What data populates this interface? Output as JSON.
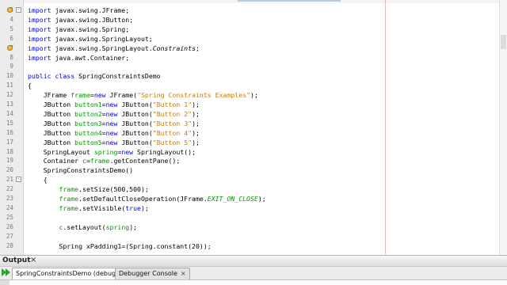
{
  "editor": {
    "lines": [
      {
        "n": "3",
        "fold": "-",
        "bulb": true,
        "tokens": [
          {
            "t": "import javax.swing.JFrame;",
            "c": "kw-lead"
          }
        ]
      },
      {
        "n": "4",
        "tokens": [
          {
            "t": "import javax.swing.JButton;",
            "c": "kw-lead"
          }
        ]
      },
      {
        "n": "5",
        "tokens": [
          {
            "t": "import javax.swing.Spring;",
            "c": "kw-lead"
          }
        ]
      },
      {
        "n": "6",
        "tokens": [
          {
            "t": "import javax.swing.SpringLayout;",
            "c": "kw-lead"
          }
        ]
      },
      {
        "n": "7",
        "bulb": true,
        "tokens": [
          {
            "t": "import",
            "c": "kw"
          },
          {
            "t": " javax.swing.SpringLayout.",
            "c": ""
          },
          {
            "t": "Constraints",
            "c": "ital"
          },
          {
            "t": ";",
            "c": ""
          }
        ]
      },
      {
        "n": "8",
        "tokens": [
          {
            "t": "import java.awt.Container;",
            "c": "kw-lead"
          }
        ]
      },
      {
        "n": "9",
        "tokens": []
      },
      {
        "n": "10",
        "tokens": [
          {
            "t": "public class",
            "c": "kw"
          },
          {
            "t": " SpringConstraintsDemo",
            "c": ""
          }
        ]
      },
      {
        "n": "11",
        "tokens": [
          {
            "t": "{",
            "c": ""
          }
        ]
      },
      {
        "n": "12",
        "tokens": [
          {
            "t": "    JFrame ",
            "c": ""
          },
          {
            "t": "frame",
            "c": "fld"
          },
          {
            "t": "=",
            "c": ""
          },
          {
            "t": "new",
            "c": "kw"
          },
          {
            "t": " JFrame(",
            "c": ""
          },
          {
            "t": "\"Spring Constraints Examples\"",
            "c": "str"
          },
          {
            "t": ");",
            "c": ""
          }
        ]
      },
      {
        "n": "13",
        "tokens": [
          {
            "t": "    JButton ",
            "c": ""
          },
          {
            "t": "button1",
            "c": "fld"
          },
          {
            "t": "=",
            "c": ""
          },
          {
            "t": "new",
            "c": "kw"
          },
          {
            "t": " JButton(",
            "c": ""
          },
          {
            "t": "\"Button 1\"",
            "c": "str"
          },
          {
            "t": ");",
            "c": ""
          }
        ]
      },
      {
        "n": "14",
        "tokens": [
          {
            "t": "    JButton ",
            "c": ""
          },
          {
            "t": "button2",
            "c": "fld"
          },
          {
            "t": "=",
            "c": ""
          },
          {
            "t": "new",
            "c": "kw"
          },
          {
            "t": " JButton(",
            "c": ""
          },
          {
            "t": "\"Button 2\"",
            "c": "str"
          },
          {
            "t": ");",
            "c": ""
          }
        ]
      },
      {
        "n": "15",
        "tokens": [
          {
            "t": "    JButton ",
            "c": ""
          },
          {
            "t": "button3",
            "c": "fld"
          },
          {
            "t": "=",
            "c": ""
          },
          {
            "t": "new",
            "c": "kw"
          },
          {
            "t": " JButton(",
            "c": ""
          },
          {
            "t": "\"Button 3\"",
            "c": "str"
          },
          {
            "t": ");",
            "c": ""
          }
        ]
      },
      {
        "n": "16",
        "tokens": [
          {
            "t": "    JButton ",
            "c": ""
          },
          {
            "t": "button4",
            "c": "fld"
          },
          {
            "t": "=",
            "c": ""
          },
          {
            "t": "new",
            "c": "kw"
          },
          {
            "t": " JButton(",
            "c": ""
          },
          {
            "t": "\"Button 4\"",
            "c": "str"
          },
          {
            "t": ");",
            "c": ""
          }
        ]
      },
      {
        "n": "17",
        "tokens": [
          {
            "t": "    JButton ",
            "c": ""
          },
          {
            "t": "button5",
            "c": "fld"
          },
          {
            "t": "=",
            "c": ""
          },
          {
            "t": "new",
            "c": "kw"
          },
          {
            "t": " JButton(",
            "c": ""
          },
          {
            "t": "\"Button 5\"",
            "c": "str"
          },
          {
            "t": ");",
            "c": ""
          }
        ]
      },
      {
        "n": "18",
        "tokens": [
          {
            "t": "    SpringLayout ",
            "c": ""
          },
          {
            "t": "spring",
            "c": "fld"
          },
          {
            "t": "=",
            "c": ""
          },
          {
            "t": "new",
            "c": "kw"
          },
          {
            "t": " SpringLayout();",
            "c": ""
          }
        ]
      },
      {
        "n": "19",
        "tokens": [
          {
            "t": "    Container ",
            "c": ""
          },
          {
            "t": "c",
            "c": "fld"
          },
          {
            "t": "=",
            "c": ""
          },
          {
            "t": "frame",
            "c": "fld"
          },
          {
            "t": ".getContentPane();",
            "c": ""
          }
        ]
      },
      {
        "n": "20",
        "tokens": [
          {
            "t": "    SpringConstraintsDemo()",
            "c": ""
          }
        ]
      },
      {
        "n": "21",
        "fold": "-",
        "tokens": [
          {
            "t": "    {",
            "c": ""
          }
        ]
      },
      {
        "n": "22",
        "tokens": [
          {
            "t": "        ",
            "c": ""
          },
          {
            "t": "frame",
            "c": "fld"
          },
          {
            "t": ".setSize(500,500);",
            "c": ""
          }
        ]
      },
      {
        "n": "23",
        "tokens": [
          {
            "t": "        ",
            "c": ""
          },
          {
            "t": "frame",
            "c": "fld"
          },
          {
            "t": ".setDefaultCloseOperation(JFrame.",
            "c": ""
          },
          {
            "t": "EXIT_ON_CLOSE",
            "c": "fld ital"
          },
          {
            "t": ");",
            "c": ""
          }
        ]
      },
      {
        "n": "24",
        "tokens": [
          {
            "t": "        ",
            "c": ""
          },
          {
            "t": "frame",
            "c": "fld"
          },
          {
            "t": ".setVisible(",
            "c": ""
          },
          {
            "t": "true",
            "c": "kw"
          },
          {
            "t": ");",
            "c": ""
          }
        ]
      },
      {
        "n": "25",
        "tokens": []
      },
      {
        "n": "26",
        "tokens": [
          {
            "t": "        ",
            "c": ""
          },
          {
            "t": "c",
            "c": "fld"
          },
          {
            "t": ".setLayout(",
            "c": ""
          },
          {
            "t": "spring",
            "c": "fld"
          },
          {
            "t": ");",
            "c": ""
          }
        ]
      },
      {
        "n": "27",
        "tokens": []
      },
      {
        "n": "28",
        "tokens": [
          {
            "t": "        Spring xPadding1=(Spring.constant(20));",
            "c": ""
          }
        ]
      }
    ]
  },
  "output_panel": {
    "title": "Output",
    "close_glyph": "×",
    "tabs": [
      {
        "label": "SpringConstraintsDemo (debug)",
        "close": "×",
        "active": true
      },
      {
        "label": "Debugger Console",
        "close": "×",
        "active": false
      }
    ]
  },
  "icons": {
    "fold": "minus-box-icon",
    "bulb": "lightbulb-icon",
    "run": "run-icon"
  }
}
